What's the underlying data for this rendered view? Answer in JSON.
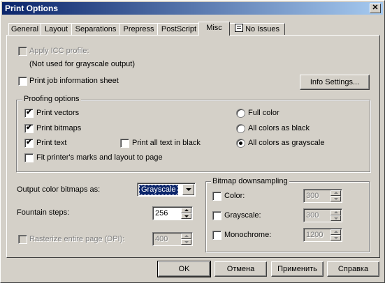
{
  "window": {
    "title": "Print Options",
    "close_glyph": "✕"
  },
  "tabs": [
    {
      "label": "General"
    },
    {
      "label": "Layout"
    },
    {
      "label": "Separations"
    },
    {
      "label": "Prepress"
    },
    {
      "label": "PostScript"
    },
    {
      "label": "Misc",
      "active": true
    },
    {
      "label": "No Issues",
      "icon": "report-icon"
    }
  ],
  "misc": {
    "apply_icc": {
      "label": "Apply ICC profile:",
      "checked": false,
      "enabled": false
    },
    "icc_note": "(Not used for grayscale output)",
    "print_job_info": {
      "label": "Print job information sheet",
      "checked": false
    },
    "info_settings_button": "Info Settings...",
    "proofing": {
      "title": "Proofing options",
      "print_vectors": {
        "label": "Print vectors",
        "checked": true
      },
      "print_bitmaps": {
        "label": "Print bitmaps",
        "checked": true
      },
      "print_text": {
        "label": "Print text",
        "checked": true
      },
      "print_all_text_black": {
        "label": "Print all text in black",
        "checked": false
      },
      "fit_printers_marks": {
        "label": "Fit printer's marks and layout to page",
        "checked": false
      },
      "full_color": {
        "label": "Full color",
        "selected": false
      },
      "all_colors_black": {
        "label": "All colors as black",
        "selected": false
      },
      "all_colors_grayscale": {
        "label": "All colors as grayscale",
        "selected": true
      }
    },
    "output_color_bitmaps": {
      "label": "Output color bitmaps as:",
      "value": "Grayscale"
    },
    "fountain_steps": {
      "label": "Fountain steps:",
      "value": "256"
    },
    "rasterize": {
      "label": "Rasterize entire page (DPI):",
      "value": "400",
      "checked": false,
      "enabled": false
    },
    "bitmap_downsampling": {
      "title": "Bitmap downsampling",
      "color": {
        "label": "Color:",
        "value": "300",
        "checked": false
      },
      "grayscale": {
        "label": "Grayscale:",
        "value": "300",
        "checked": false
      },
      "monochrome": {
        "label": "Monochrome:",
        "value": "1200",
        "checked": false
      }
    }
  },
  "buttons": {
    "ok": "OK",
    "cancel": "Отмена",
    "apply": "Применить",
    "help": "Справка"
  }
}
